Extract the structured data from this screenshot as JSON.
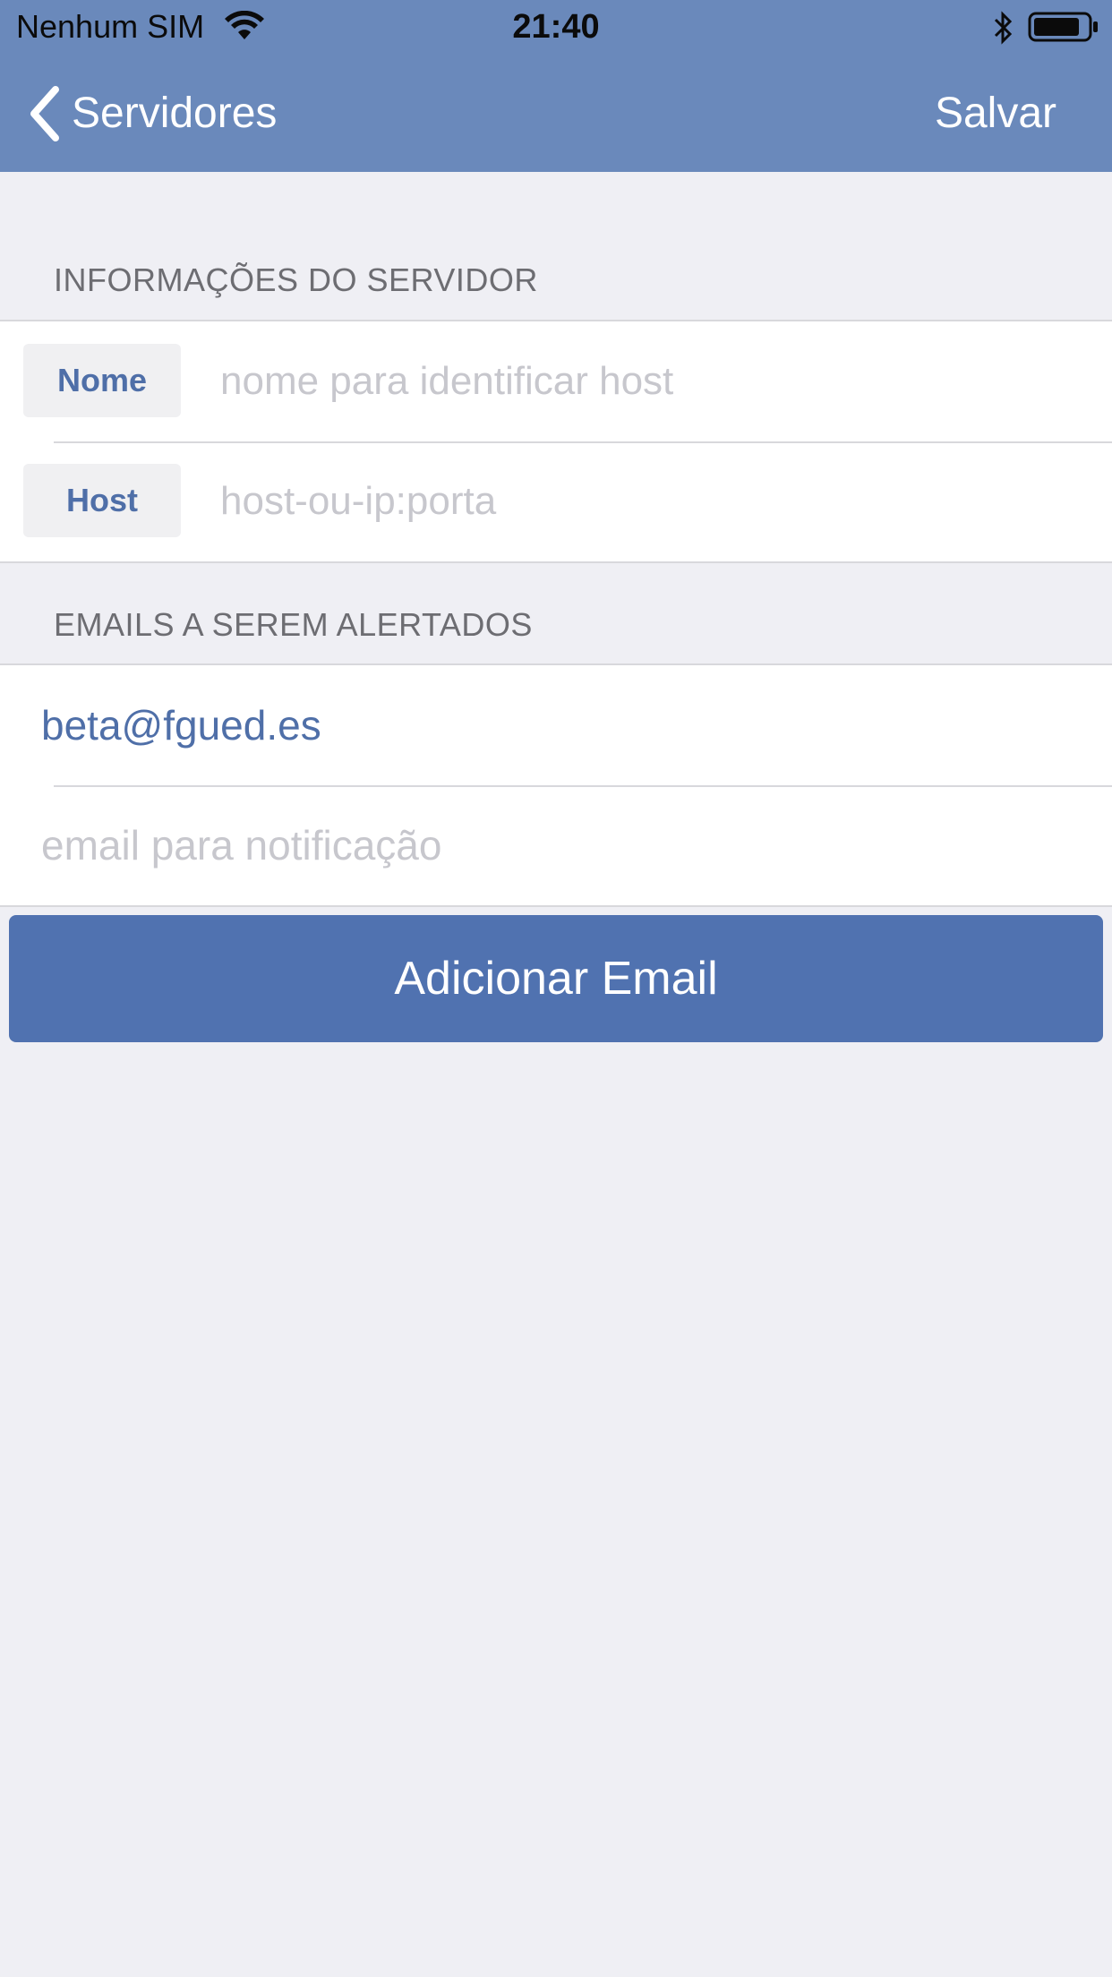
{
  "status_bar": {
    "carrier": "Nenhum SIM",
    "time": "21:40",
    "icons": [
      "wifi-icon",
      "bluetooth-icon",
      "battery-icon"
    ]
  },
  "nav": {
    "back_label": "Servidores",
    "save_label": "Salvar",
    "background": "#6a89bb"
  },
  "server_section": {
    "title": "INFORMAÇÕES DO SERVIDOR",
    "fields": [
      {
        "label": "Nome",
        "placeholder": "nome para identificar host"
      },
      {
        "label": "Host",
        "placeholder": "host-ou-ip:porta"
      }
    ]
  },
  "emails_section": {
    "title": "EMAILS A SEREM ALERTADOS",
    "emails": [
      "beta@fgued.es"
    ],
    "new_email_placeholder": "email para notificação"
  },
  "add_button": {
    "label": "Adicionar Email",
    "color": "#5072b0"
  }
}
